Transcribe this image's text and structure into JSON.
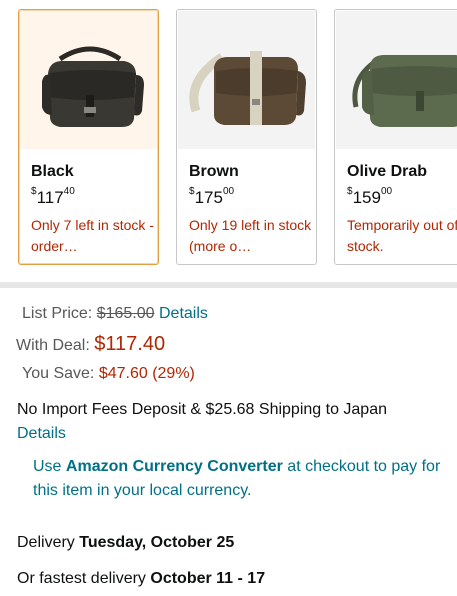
{
  "variants": [
    {
      "color": "Black",
      "price_whole": "117",
      "price_fraction": "40",
      "currency": "$",
      "availability": "Only 7 left in stock - order…",
      "selected": true
    },
    {
      "color": "Brown",
      "price_whole": "175",
      "price_fraction": "00",
      "currency": "$",
      "availability": "Only 19 left in stock (more o…",
      "selected": false
    },
    {
      "color": "Olive Drab",
      "price_whole": "159",
      "price_fraction": "00",
      "currency": "$",
      "availability": "Temporarily out of stock.",
      "selected": false
    }
  ],
  "pricing": {
    "list_price_label": "List Price:",
    "list_price_value": "$165.00",
    "details_link": "Details",
    "with_deal_label": "With Deal:",
    "with_deal_value": "$117.40",
    "you_save_label": "You Save:",
    "you_save_value": "$47.60 (29%)"
  },
  "shipping": {
    "text": "No Import Fees Deposit & $25.68 Shipping to Japan",
    "details_link": "Details"
  },
  "currency_converter": {
    "prefix": "Use ",
    "link": "Amazon Currency Converter",
    "suffix": " at checkout to pay for this item in your local currency."
  },
  "delivery": {
    "label": "Delivery ",
    "date": "Tuesday, October 25",
    "fastest_label": "Or fastest delivery ",
    "fastest_date": "October 11 - 17"
  },
  "colors": {
    "price_red": "#b12704",
    "link_teal": "#007185",
    "selected_border": "#e3a043"
  }
}
